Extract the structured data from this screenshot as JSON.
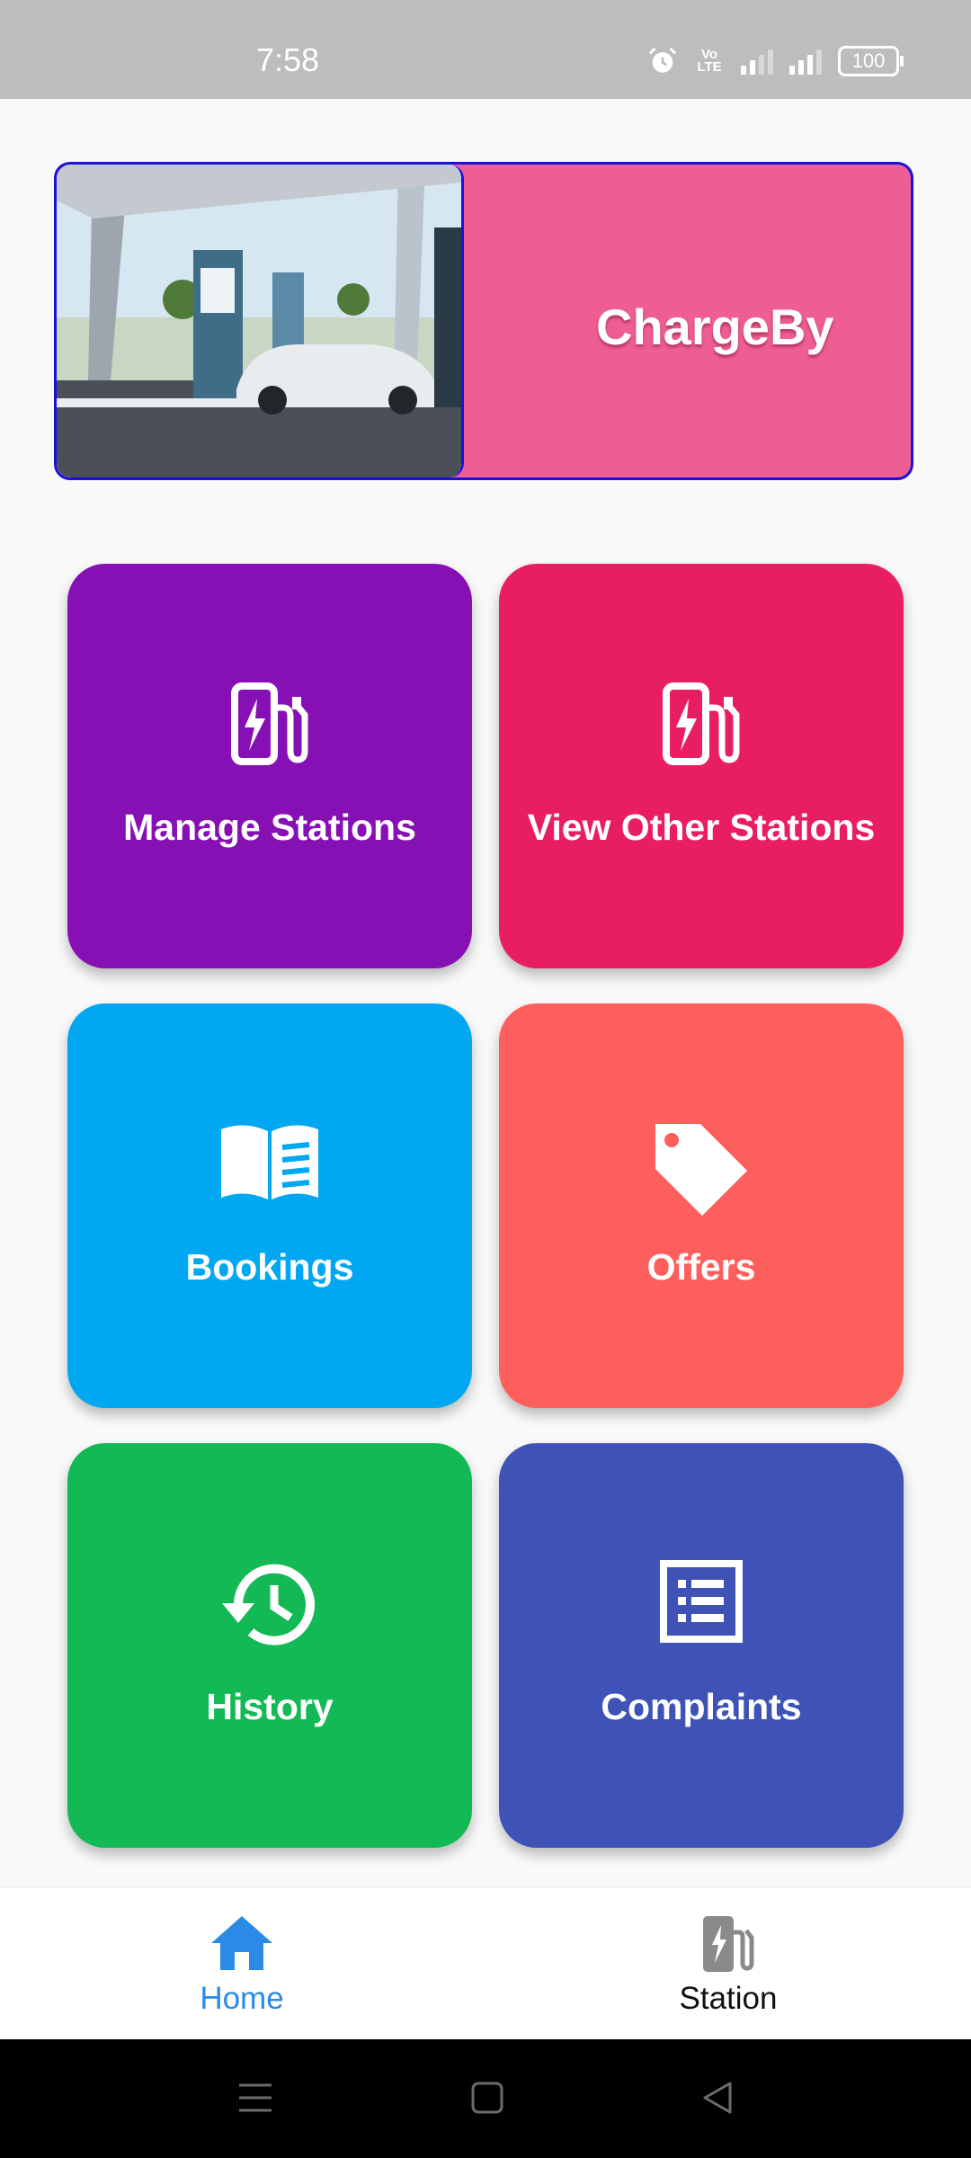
{
  "status_bar": {
    "time": "7:58",
    "volte": "Vo LTE",
    "battery": "100"
  },
  "banner": {
    "title": "ChargeBy"
  },
  "tiles": [
    {
      "label": "Manage Stations",
      "icon": "ev-station-icon",
      "color": "#8710b5"
    },
    {
      "label": "View Other Stations",
      "icon": "ev-station-icon",
      "color": "#e91e62"
    },
    {
      "label": "Bookings",
      "icon": "book-icon",
      "color": "#02a7f1"
    },
    {
      "label": "Offers",
      "icon": "tag-icon",
      "color": "#ff5f5c"
    },
    {
      "label": "History",
      "icon": "history-icon",
      "color": "#13b954"
    },
    {
      "label": "Complaints",
      "icon": "list-icon",
      "color": "#3f52b5"
    }
  ],
  "bottom_nav": {
    "items": [
      {
        "label": "Home",
        "icon": "home-icon",
        "active": true
      },
      {
        "label": "Station",
        "icon": "ev-station-icon",
        "active": false
      }
    ]
  },
  "colors": {
    "accent": "#2b8ae6",
    "banner": "#ef5e93",
    "banner_border": "#1a10e0"
  }
}
